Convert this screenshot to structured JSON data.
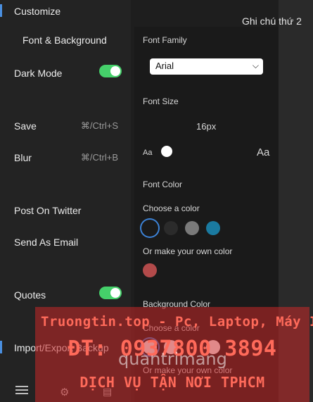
{
  "menu": {
    "customize": "Customize",
    "font_background": "Font & Background",
    "dark_mode": "Dark Mode",
    "save": "Save",
    "save_shortcut": "⌘/Ctrl+S",
    "blur": "Blur",
    "blur_shortcut": "⌘/Ctrl+B",
    "post_twitter": "Post On Twitter",
    "send_email": "Send As Email",
    "quotes": "Quotes",
    "import_export": "Import/Export Backup"
  },
  "note_title": "Ghi chú thứ 2",
  "settings": {
    "font_family_label": "Font Family",
    "font_family_value": "Arial",
    "font_size_label": "Font Size",
    "font_size_value": "16px",
    "aa_small": "Aa",
    "aa_large": "Aa",
    "font_color_label": "Font Color",
    "choose_color_label": "Choose a color",
    "own_color_label": "Or make your own color",
    "background_color_label": "Background Color",
    "bg_choose_color_label": "Choose a color",
    "bg_own_color_label": "Or make your own color",
    "font_colors": [
      "#1a1a1a",
      "#2b2b2b",
      "#7a7a7a",
      "#1a7aa0"
    ],
    "custom_font_color": "#b24a4a",
    "bg_colors": [
      "#ffffff",
      "#ffffff",
      "#ffffff"
    ]
  },
  "toggles": {
    "dark_mode_on": true,
    "quotes_on": true
  },
  "watermark": {
    "line1": "Truongtin.top - Pc, Laptop, Máy In",
    "line2": "ĐT: 0937800 3894",
    "line3": "DỊCH VỤ TẬN NƠI TPHCM",
    "brand": "quantrimang"
  }
}
